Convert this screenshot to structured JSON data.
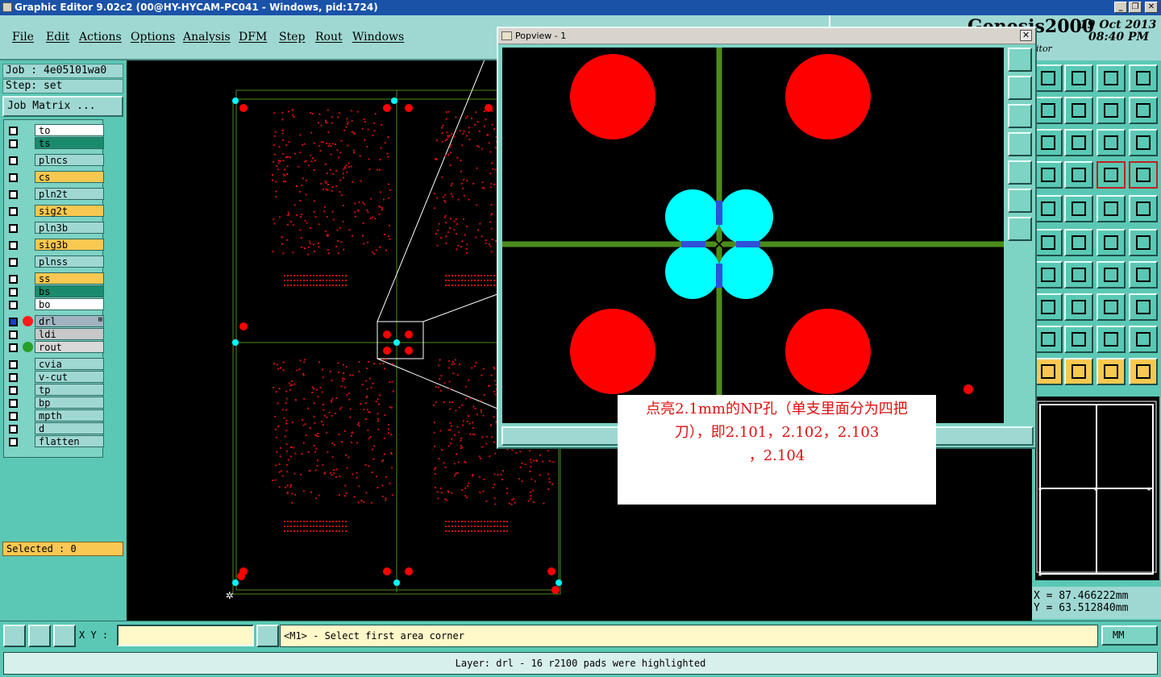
{
  "window": {
    "title": "Graphic Editor 9.02c2 (00@HY-HYCAM-PC041 - Windows, pid:1724)",
    "controls": [
      "_",
      "❐",
      "✕"
    ]
  },
  "menu": {
    "items": [
      "File",
      "Edit",
      "Actions",
      "Options",
      "Analysis",
      "DFM",
      "Step",
      "Rout",
      "Windows"
    ]
  },
  "brand": {
    "name": "Genesis2000",
    "subtitle": "itor",
    "date": "19 Oct 2013",
    "time": "08:40 PM"
  },
  "left": {
    "job": "Job : 4e05101wa0",
    "step": "Step: set",
    "job_matrix": "Job Matrix ...",
    "selected": "Selected : 0"
  },
  "layers": [
    {
      "name": "to",
      "bg": "#ffffff"
    },
    {
      "name": "ts",
      "bg": "#1a8a6c"
    },
    {
      "name": "plncs",
      "bg": "#9fd8d2"
    },
    {
      "name": "cs",
      "bg": "#f8c850"
    },
    {
      "name": "pln2t",
      "bg": "#9fd8d2"
    },
    {
      "name": "sig2t",
      "bg": "#f8c850"
    },
    {
      "name": "pln3b",
      "bg": "#9fd8d2"
    },
    {
      "name": "sig3b",
      "bg": "#f8c850"
    },
    {
      "name": "plnss",
      "bg": "#9fd8d2"
    },
    {
      "name": "ss",
      "bg": "#f8c850"
    },
    {
      "name": "bs",
      "bg": "#1a8a6c"
    },
    {
      "name": "bo",
      "bg": "#ffffff"
    },
    {
      "name": "drl",
      "bg": "#9fb4c0",
      "dot": "#ff1a1a",
      "mark": "⊞"
    },
    {
      "name": "ldi",
      "bg": "#c8c8c8"
    },
    {
      "name": "rout",
      "bg": "#d8d8d8",
      "dot": "#28a028"
    },
    {
      "name": "cvia",
      "bg": "#9fd8d2"
    },
    {
      "name": "v-cut",
      "bg": "#9fd8d2"
    },
    {
      "name": "tp",
      "bg": "#9fd8d2"
    },
    {
      "name": "bp",
      "bg": "#9fd8d2"
    },
    {
      "name": "mpth",
      "bg": "#9fd8d2"
    },
    {
      "name": "d",
      "bg": "#9fd8d2"
    },
    {
      "name": "flatten",
      "bg": "#9fd8d2"
    }
  ],
  "popview": {
    "title": "Popview - 1",
    "close": "✕"
  },
  "annotation": {
    "line1": "点亮2.1mm的NP孔（单支里面分为四把",
    "line2": "刀），即2.101，2.102，2.103",
    "line3": "，2.104"
  },
  "coords": {
    "x": "X = 87.466222mm",
    "y": "Y = 63.512840mm"
  },
  "bottom": {
    "xy_label": "X Y :",
    "xy_value": "",
    "prompt": "<M1> - Select first area corner",
    "units": "MM",
    "status": "Layer: drl - 16 r2100 pads were highlighted"
  },
  "colors": {
    "panel": "#5ac8b4",
    "panel_light": "#9fd8d2",
    "canvas": "#000000",
    "drill_pad": "#ff0000",
    "highlight": "#00ffff",
    "profile": "#4c8c1c",
    "annotation_text": "#e01010"
  }
}
